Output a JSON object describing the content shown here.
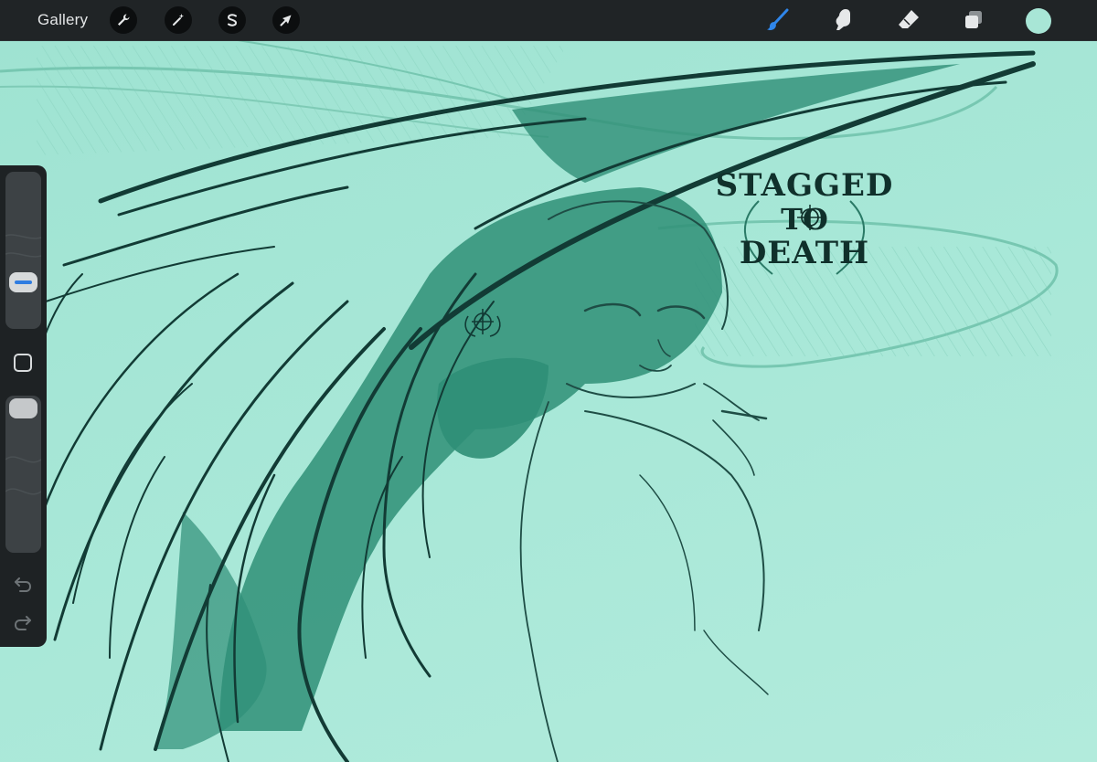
{
  "toolbar": {
    "gallery_label": "Gallery",
    "left_tools": [
      "wrench-icon",
      "magic-wand-icon",
      "selection-s-icon",
      "transform-arrow-icon"
    ],
    "right_tools": [
      "brush-icon",
      "smudge-icon",
      "eraser-icon",
      "layers-icon"
    ],
    "active_tool": "brush-icon",
    "current_color": "#a8e6d6"
  },
  "sidebar": {
    "controls": [
      "brush-size-slider",
      "modify-button",
      "opacity-slider",
      "undo-icon",
      "redo-icon"
    ]
  },
  "canvas": {
    "background_color": "#a8e6d6",
    "ink_color": "#123b35",
    "shade_color": "#2f8f77",
    "artwork_text": [
      "STAGGED",
      "TO",
      "DEATH"
    ]
  }
}
